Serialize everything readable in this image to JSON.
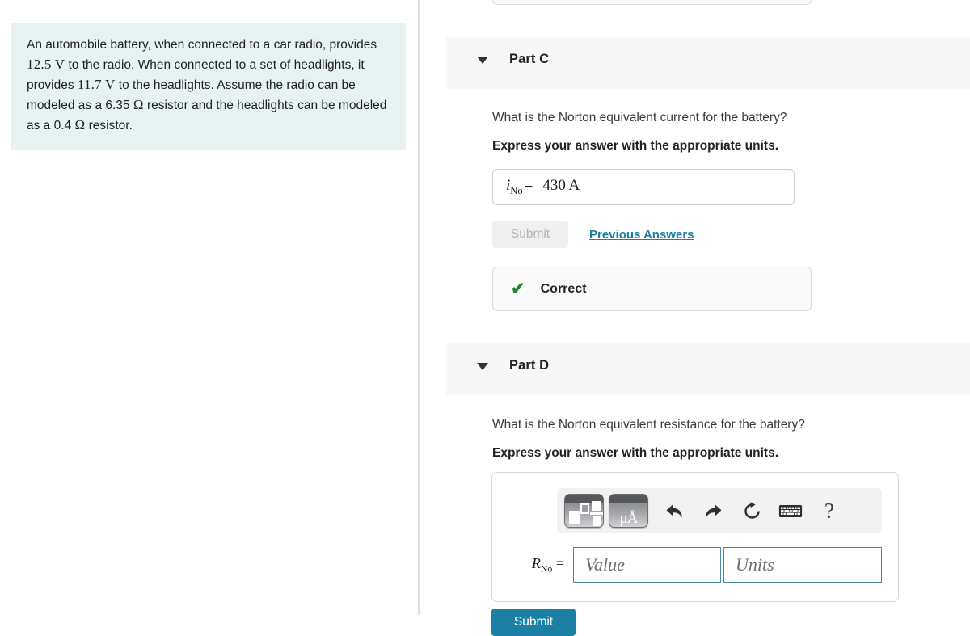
{
  "problem": {
    "text_segments": [
      {
        "t": "An automobile battery, when connected to a car radio, provides ",
        "k": "plain"
      },
      {
        "t": "12.5",
        "k": "plain"
      },
      {
        "t": " V ",
        "k": "math"
      },
      {
        "t": "to the radio. When connected to a set of headlights, it provides ",
        "k": "plain"
      },
      {
        "t": "11.7",
        "k": "plain"
      },
      {
        "t": " V ",
        "k": "math"
      },
      {
        "t": "to the headlights. Assume the radio can be modeled as a 6.35 ",
        "k": "plain"
      },
      {
        "t": "Ω",
        "k": "math"
      },
      {
        "t": " resistor and the headlights can be modeled as a 0.4 ",
        "k": "plain"
      },
      {
        "t": "Ω",
        "k": "math"
      },
      {
        "t": " resistor.",
        "k": "plain"
      }
    ],
    "full_text": "An automobile battery, when connected to a car radio, provides 12.5 V to the radio. When connected to a set of headlights, it provides 11.7 V to the headlights. Assume the radio can be modeled as a 6.35 Ω resistor and the headlights can be modeled as a 0.4 Ω resistor.",
    "background_color": "#e7f3f2",
    "values": {
      "radio_voltage": "12.5 V",
      "headlight_voltage": "11.7 V",
      "radio_resistance": "6.35 Ω",
      "headlight_resistance": "0.4 Ω"
    }
  },
  "part_c": {
    "title": "Part C",
    "caret_icon": "caret-down-icon",
    "question": "What is the Norton equivalent current for the battery?",
    "instruction": "Express your answer with the appropriate units.",
    "answer": {
      "symbol": "i",
      "subscript": "No",
      "equals": "=",
      "value": "430 A"
    },
    "submit_label": "Submit",
    "submit_disabled": true,
    "previous_answers_label": "Previous Answers",
    "previous_answers_color": "#1c7fa4",
    "feedback": {
      "icon": "check-icon",
      "label": "Correct",
      "icon_color": "#1f8435",
      "check_glyph": "✔"
    }
  },
  "part_d": {
    "title": "Part D",
    "caret_icon": "caret-down-icon",
    "question": "What is the Norton equivalent resistance for the battery?",
    "instruction": "Express your answer with the appropriate units.",
    "toolbar": {
      "buttons": [
        {
          "name": "math-template-button",
          "label": "",
          "icon": "math-template-icon"
        },
        {
          "name": "units-button",
          "label": "μÅ",
          "icon": "units-icon"
        },
        {
          "name": "undo-button",
          "label": "",
          "icon": "undo-arrow-icon"
        },
        {
          "name": "redo-button",
          "label": "",
          "icon": "redo-arrow-icon"
        },
        {
          "name": "reset-button",
          "label": "",
          "icon": "reset-circular-arrow-icon"
        },
        {
          "name": "keyboard-button",
          "label": "",
          "icon": "keyboard-icon"
        },
        {
          "name": "help-button",
          "label": "?",
          "icon": "question-mark-icon"
        }
      ]
    },
    "answer": {
      "symbol": "R",
      "subscript": "No",
      "equals": "=",
      "value_placeholder": "Value",
      "units_placeholder": "Units",
      "value": "",
      "units": "",
      "border_color": "#4a87a8"
    },
    "submit_label": "Submit",
    "submit_color": "#1c7fa4"
  }
}
